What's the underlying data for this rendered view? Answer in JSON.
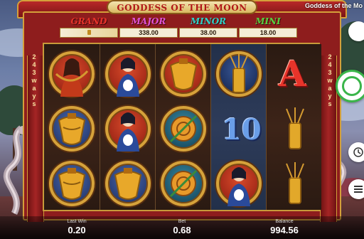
{
  "game": {
    "title": "GODDESS OF THE MOON",
    "corner_name": "Goddess of the Mo"
  },
  "jackpots": [
    {
      "label": "GRAND",
      "value": "",
      "locked": true
    },
    {
      "label": "MAJOR",
      "value": "338.00"
    },
    {
      "label": "MINOR",
      "value": "38.00"
    },
    {
      "label": "MINI",
      "value": "18.00"
    }
  ],
  "ways": {
    "left": [
      "2",
      "4",
      "3",
      "w",
      "a",
      "y",
      "s"
    ],
    "right": [
      "2",
      "4",
      "3",
      "w",
      "a",
      "y",
      "s"
    ]
  },
  "reels": [
    [
      "warrior-woman",
      "golden-lantern",
      "golden-lantern"
    ],
    [
      "goddess-with-rabbit",
      "goddess-with-rabbit",
      "golden-lantern"
    ],
    [
      "golden-lantern",
      "mooncake",
      "mooncake"
    ],
    [
      "arrow-quiver",
      "ten",
      "goddess-with-rabbit"
    ],
    [
      "ace",
      "arrow-quiver",
      "arrow-quiver"
    ]
  ],
  "symbols": {
    "ten": "10",
    "ace": "A"
  },
  "status": {
    "last_win_label": "Last Win",
    "last_win": "0.20",
    "bet_label": "Bet",
    "bet": "0.68",
    "balance_label": "Balance",
    "balance": "994.56"
  },
  "colors": {
    "frame": "#8e1d1d",
    "gold": "#d4a03a",
    "spin": "#3ab54a",
    "grand": "#e6332a",
    "major": "#e052d6",
    "minor": "#2fd0c8",
    "mini": "#58d040"
  }
}
